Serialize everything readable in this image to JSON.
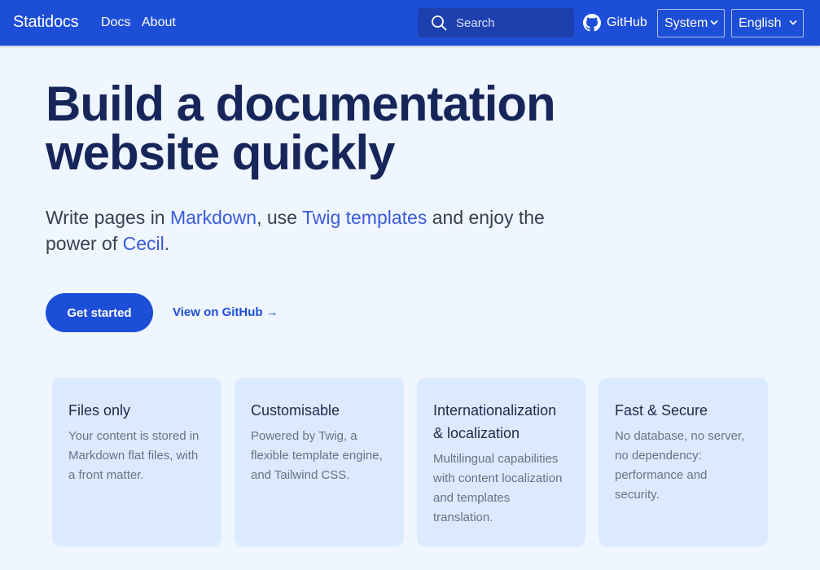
{
  "header": {
    "brand": "Statidocs",
    "nav": [
      {
        "label": "Docs"
      },
      {
        "label": "About"
      }
    ],
    "search_placeholder": "Search",
    "github_label": "GitHub",
    "theme_select": "System",
    "language_select": "English"
  },
  "hero": {
    "title_line1": "Build a documentation",
    "title_line2": "website quickly",
    "sub_1": "Write pages in ",
    "sub_markdown": "Markdown",
    "sub_2": ", use ",
    "sub_twig": "Twig templates",
    "sub_3": " and enjoy the power of ",
    "sub_cecil": "Cecil",
    "sub_4": ".",
    "cta_primary": "Get started",
    "cta_secondary": "View on GitHub →"
  },
  "features": [
    {
      "title": "Files only",
      "text": "Your content is stored in Markdown flat files, with a front matter."
    },
    {
      "title": "Customisable",
      "text": "Powered by Twig, a flexible template engine, and Tailwind CSS."
    },
    {
      "title": "Internationalization & localization",
      "text": "Multilingual capabilities with content localization and templates translation."
    },
    {
      "title": "Fast & Secure",
      "text": "No database, no server, no dependency: performance and security."
    }
  ],
  "colors": {
    "header_bg": "#1d4ed8",
    "page_bg": "#eff6ff",
    "card_bg": "#dbeafe",
    "accent": "#1d4ed8"
  }
}
